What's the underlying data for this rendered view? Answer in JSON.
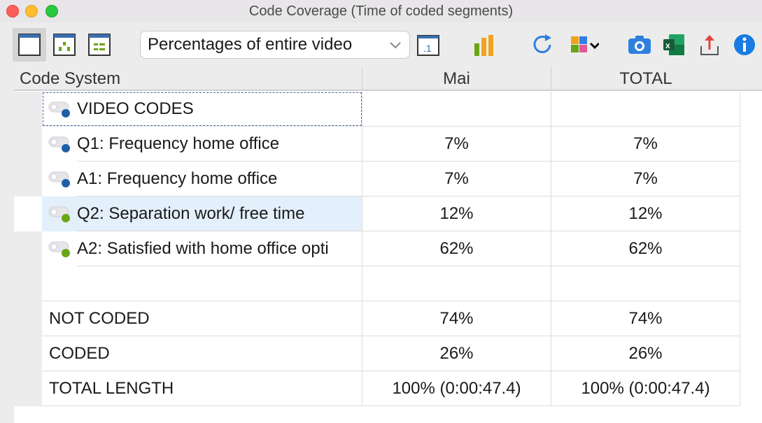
{
  "window": {
    "title": "Code Coverage (Time of coded segments)"
  },
  "toolbar": {
    "view_buttons": [
      {
        "icon": "single-pane-icon",
        "selected": true
      },
      {
        "icon": "bar-layout-icon",
        "selected": false
      },
      {
        "icon": "segment-layout-icon",
        "selected": false
      }
    ],
    "dropdown_value": "Percentages of entire video",
    "icons": [
      "decimal-places-icon",
      "bar-chart-icon",
      "refresh-icon",
      "puzzle-icon",
      "camera-icon",
      "excel-export-icon",
      "export-icon",
      "info-icon"
    ]
  },
  "table": {
    "headers": {
      "code_system": "Code System",
      "mai": "Mai",
      "total": "TOTAL"
    },
    "codes": [
      {
        "label": "VIDEO CODES",
        "mai": "",
        "total": "",
        "color": "#1f5fa8",
        "is_parent": true
      },
      {
        "label": "Q1: Frequency home office",
        "mai": "7%",
        "total": "7%",
        "color": "#1f5fa8"
      },
      {
        "label": "A1: Frequency home office",
        "mai": "7%",
        "total": "7%",
        "color": "#1f5fa8"
      },
      {
        "label": "Q2: Separation work/ free time",
        "mai": "12%",
        "total": "12%",
        "color": "#6aa515"
      },
      {
        "label": "A2: Satisfied with home office opti",
        "mai": "62%",
        "total": "62%",
        "color": "#6aa515"
      }
    ],
    "summary": [
      {
        "label": "NOT CODED",
        "mai": "74%",
        "total": "74%"
      },
      {
        "label": "CODED",
        "mai": "26%",
        "total": "26%"
      },
      {
        "label": "TOTAL LENGTH",
        "mai": "100% (0:00:47.4)",
        "total": "100% (0:00:47.4)"
      }
    ]
  }
}
